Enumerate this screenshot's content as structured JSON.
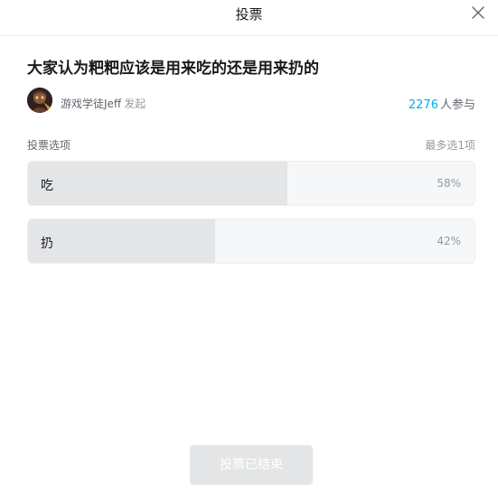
{
  "header": {
    "title": "投票",
    "close_icon": "close-icon"
  },
  "poll": {
    "question": "大家认为粑粑应该是用来吃的还是用来扔的",
    "author": {
      "name": "游戏学徒Jeff",
      "action": "发起",
      "avatar_icon": "avatar"
    },
    "participants": {
      "count": "2276",
      "suffix": "人参与"
    },
    "options_label": "投票选项",
    "options_limit": "最多选1项",
    "options": [
      {
        "label": "吃",
        "percent_text": "58%",
        "percent": 58
      },
      {
        "label": "扔",
        "percent_text": "42%",
        "percent": 42
      }
    ]
  },
  "footer": {
    "button_label": "投票已结束"
  },
  "colors": {
    "accent": "#00aeec",
    "bar_fill": "#e3e5e7",
    "bar_bg": "#f6f7f8"
  }
}
